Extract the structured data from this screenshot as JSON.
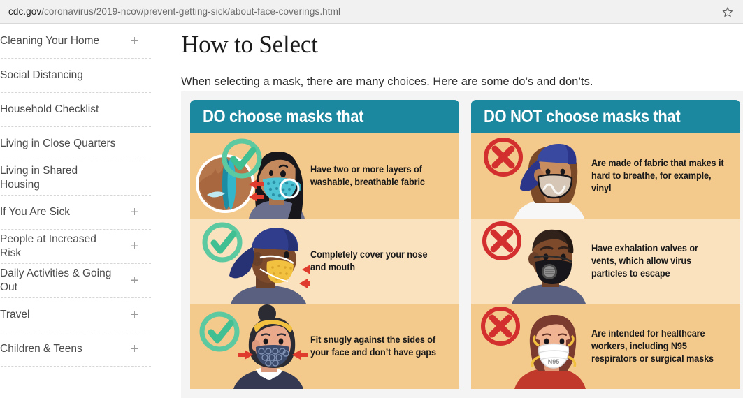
{
  "browser": {
    "url_domain": "cdc.gov",
    "url_path": "/coronavirus/2019-ncov/prevent-getting-sick/about-face-coverings.html",
    "bookmark_icon": "star-icon"
  },
  "sidebar": {
    "items": [
      {
        "label": "Cleaning Your Home",
        "expandable": true,
        "expand_icon": "plus-icon"
      },
      {
        "label": "Social Distancing",
        "expandable": false,
        "expand_icon": "plus-icon"
      },
      {
        "label": "Household Checklist",
        "expandable": false,
        "expand_icon": "plus-icon"
      },
      {
        "label": "Living in Close Quarters",
        "expandable": false,
        "expand_icon": "plus-icon"
      },
      {
        "label": "Living in Shared Housing",
        "expandable": false,
        "expand_icon": "plus-icon"
      },
      {
        "label": "If You Are Sick",
        "expandable": true,
        "expand_icon": "plus-icon"
      },
      {
        "label": "People at Increased Risk",
        "expandable": true,
        "expand_icon": "plus-icon"
      },
      {
        "label": "Daily Activities & Going Out",
        "expandable": true,
        "expand_icon": "plus-icon"
      },
      {
        "label": "Travel",
        "expandable": true,
        "expand_icon": "plus-icon"
      },
      {
        "label": "Children & Teens",
        "expandable": true,
        "expand_icon": "plus-icon"
      }
    ]
  },
  "main": {
    "title": "How to Select",
    "intro": "When selecting a mask, there are many choices. Here are some do’s and don’ts."
  },
  "infographic": {
    "header_color": "#1b88a0",
    "row_color_a": "#f4c98c",
    "row_color_b": "#fbe2bf",
    "background_color": "#f4f4f4",
    "check_color": "#5cc9a0",
    "cross_color": "#d32f2f",
    "arrow_color": "#e03c2d",
    "panels": [
      {
        "header": "DO choose masks that",
        "type": "do",
        "rows": [
          {
            "text": "Have two or more layers of washable, breathable fabric",
            "mark": "green-check-icon",
            "art": "woman-teal-patterned-mask-with-fabric-magnifier"
          },
          {
            "text": "Completely cover your nose and mouth",
            "mark": "green-check-icon",
            "art": "man-blue-cap-yellow-mask-side-profile"
          },
          {
            "text": "Fit snugly against the sides of your face and don’t have gaps",
            "mark": "green-check-icon",
            "art": "woman-hair-bun-navy-patterned-mask"
          }
        ]
      },
      {
        "header": "DO NOT choose masks that",
        "type": "dont",
        "rows": [
          {
            "text": "Are made of fabric that makes it hard to breathe, for example, vinyl",
            "mark": "red-x-icon",
            "art": "woman-blue-cap-shiny-vinyl-mask"
          },
          {
            "text": "Have exhalation valves or vents, which allow virus particles to escape",
            "mark": "red-x-icon",
            "art": "man-black-mask-with-exhalation-valve"
          },
          {
            "text": "Are intended for healthcare workers, including N95 respirators or surgical masks",
            "mark": "red-x-icon",
            "art": "woman-white-n95-respirator",
            "art_label": "N95"
          }
        ]
      }
    ]
  }
}
